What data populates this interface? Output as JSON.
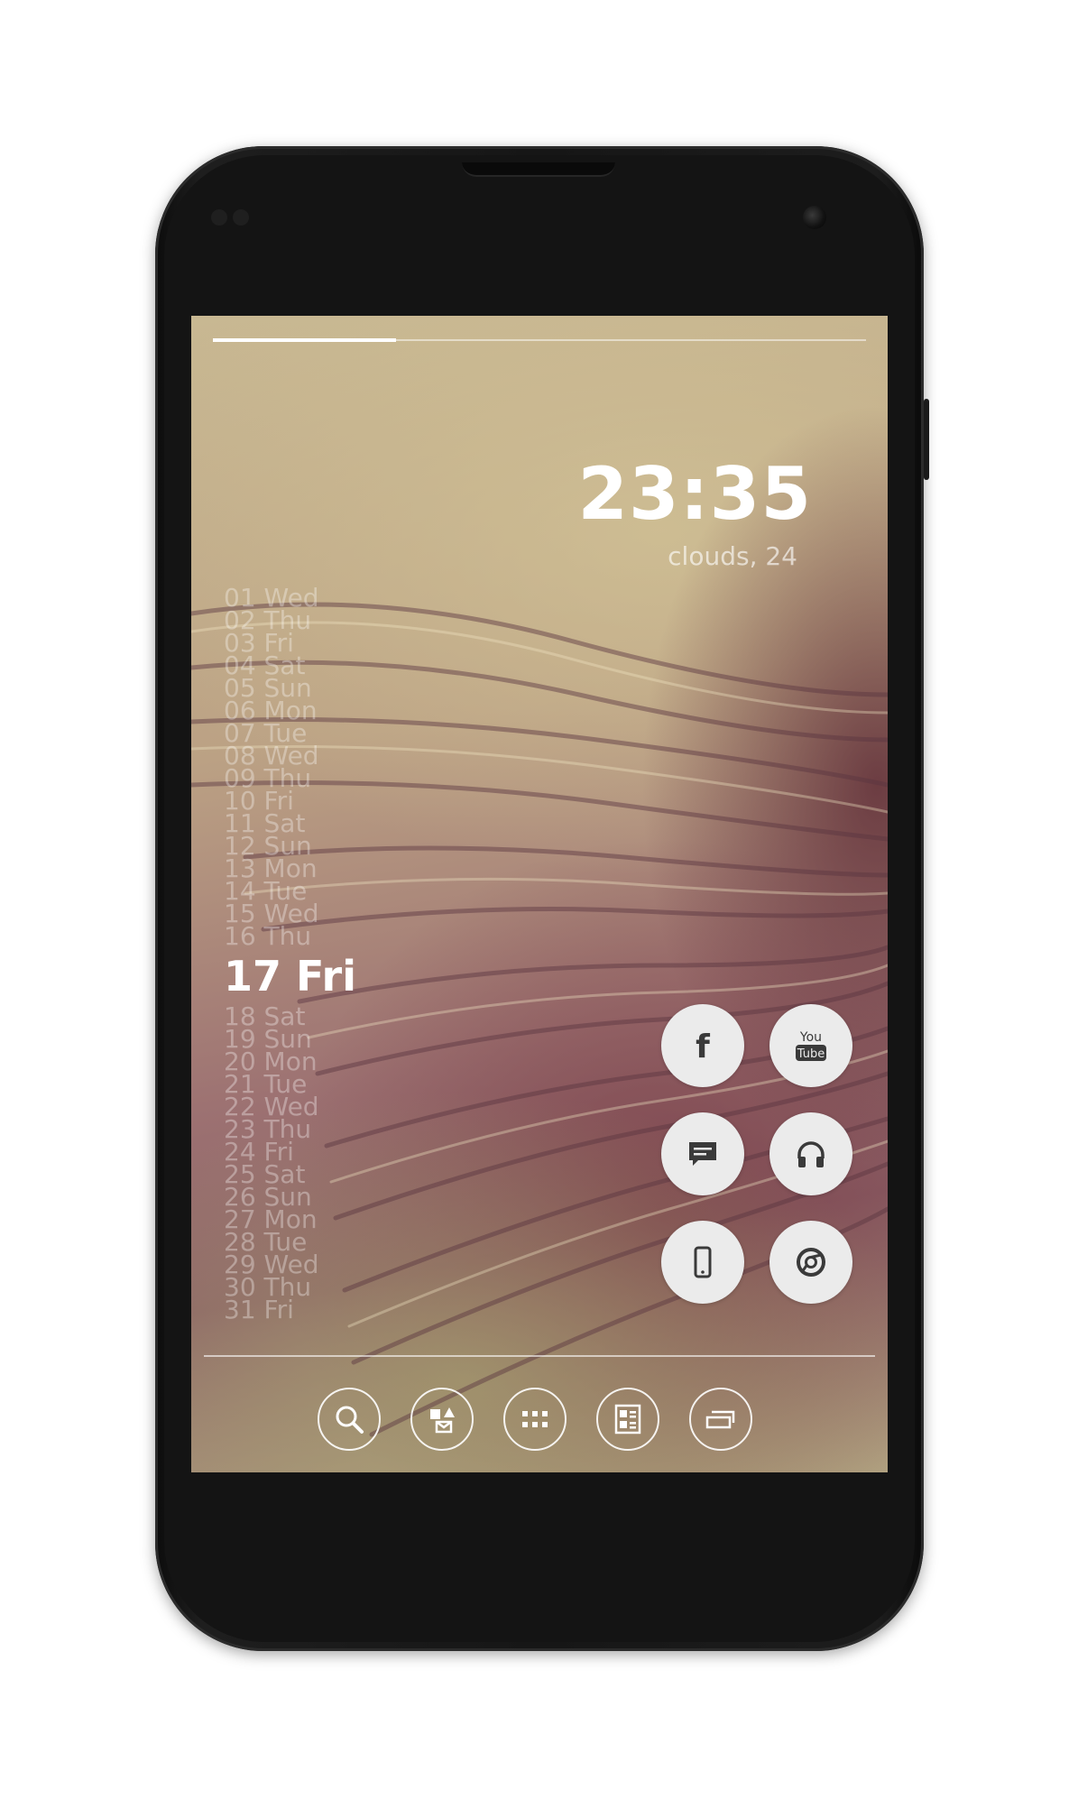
{
  "status": {
    "progress": 0.28
  },
  "clock": {
    "time": "23:35",
    "weather": "clouds, 24"
  },
  "calendar": {
    "days_before": [
      "01 Wed",
      "02 Thu",
      "03 Fri",
      "04 Sat",
      "05 Sun",
      "06 Mon",
      "07 Tue",
      "08 Wed",
      "09 Thu",
      "10 Fri",
      "11 Sat",
      "12 Sun",
      "13 Mon",
      "14 Tue",
      "15 Wed",
      "16 Thu"
    ],
    "today": "17 Fri",
    "days_after": [
      "18 Sat",
      "19 Sun",
      "20 Mon",
      "21 Tue",
      "22 Wed",
      "23 Thu",
      "24 Fri",
      "25 Sat",
      "26 Sun",
      "27 Mon",
      "28 Tue",
      "29 Wed",
      "30 Thu",
      "31 Fri"
    ]
  },
  "apps": [
    {
      "icon": "facebook-icon",
      "glyph": "f"
    },
    {
      "icon": "youtube-icon",
      "glyph_top": "You",
      "glyph_bottom": "Tube"
    },
    {
      "icon": "messaging-icon"
    },
    {
      "icon": "headphones-icon"
    },
    {
      "icon": "phone-icon"
    },
    {
      "icon": "chrome-icon"
    }
  ],
  "dock": [
    {
      "icon": "search-icon"
    },
    {
      "icon": "shapes-icon"
    },
    {
      "icon": "app-drawer-icon"
    },
    {
      "icon": "contacts-icon"
    },
    {
      "icon": "recent-apps-icon"
    }
  ],
  "colors": {
    "icon_bg": "#ebebeb",
    "icon_fg": "#3a3a3a",
    "text": "#ffffff"
  }
}
